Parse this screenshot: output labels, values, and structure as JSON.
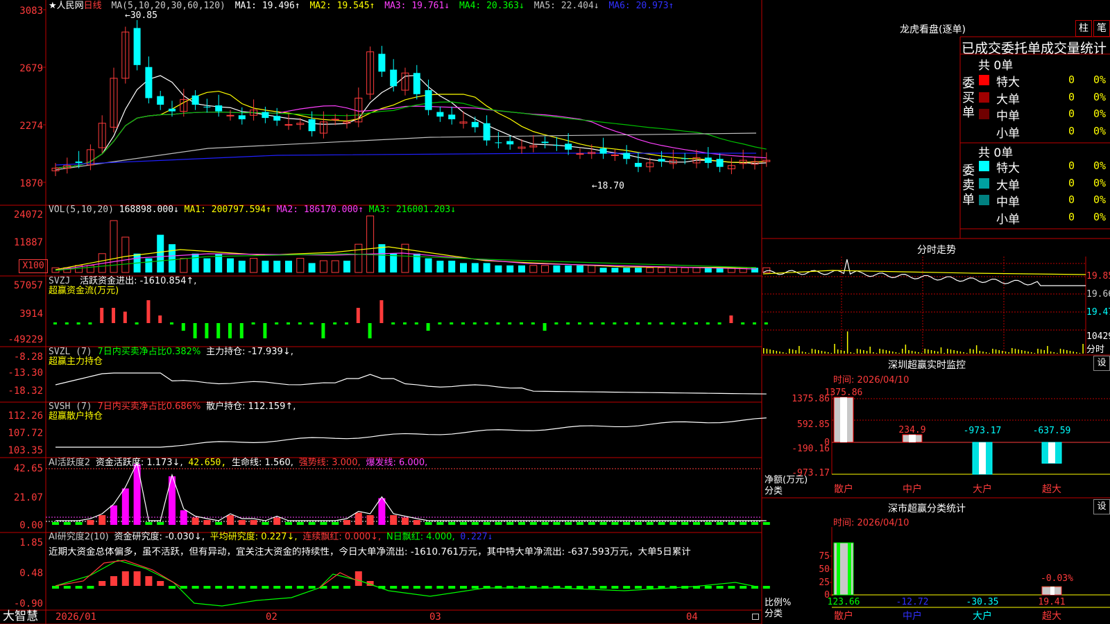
{
  "colors": {
    "up": "#ff3b3b",
    "down": "#00ffff",
    "ma_white": "#ffffff",
    "ma_yellow": "#ffff00",
    "ma_magenta": "#ff40ff",
    "ma_green": "#00c000",
    "ma_gray": "#c0c0c0",
    "ma_blue": "#2020ff",
    "grid": "#c00000",
    "green": "#00ff00"
  },
  "main": {
    "title": "★人民网",
    "period": "日线",
    "ma_label": "MA(5,10,20,30,60,120)",
    "ma1": "MA1: 19.496↑",
    "ma2": "MA2: 19.545↑",
    "ma3": "MA3: 19.761↓",
    "ma4": "MA4: 20.363↓",
    "ma5": "MA5: 22.404↓",
    "ma6": "MA6: 20.973↑",
    "high_label": "←30.85",
    "low_label": "←18.70",
    "y_ticks": [
      "3083",
      "2679",
      "2274",
      "1870"
    ]
  },
  "vol": {
    "label": "VOL(5,10,20)",
    "value": "168898.000↓",
    "ma1": "MA1: 200797.594↑",
    "ma2": "MA2: 186170.000↑",
    "ma3": "MA3: 216001.203↓",
    "y_ticks": [
      "24072",
      "11887"
    ],
    "unit": "X100"
  },
  "svzj": {
    "label": "SVZJ",
    "text": "活跃资金进出: -1610.854↑,",
    "sub": "超赢资金流(万元)",
    "y_ticks": [
      "57057",
      "3914",
      "-49229"
    ]
  },
  "svzl": {
    "label": "SVZL (7)",
    "text1": "7日内买卖净占比0.382%",
    "text2": "主力持仓: -17.939↓,",
    "sub": "超赢主力持仓",
    "y_ticks": [
      "-8.28",
      "-13.30",
      "-18.32"
    ]
  },
  "svsh": {
    "label": "SVSH (7)",
    "text1": "7日内买卖净占比0.686%",
    "text2": "散户持仓: 112.159↑,",
    "sub": "超赢散户持仓",
    "y_ticks": [
      "112.26",
      "107.72",
      "103.35"
    ]
  },
  "ai1": {
    "label": "AI活跃度2",
    "t1": "资金活跃度: 1.173↓,",
    "t2": "42.650,",
    "t3": "生命线: 1.560,",
    "t4": "强势线: 3.000,",
    "t5": "爆发线: 6.000,",
    "y_ticks": [
      "42.65",
      "21.07",
      "0.00"
    ]
  },
  "ai2": {
    "label": "AI研究度2(10)",
    "t1": "资金研究度: -0.030↓,",
    "t2": "平均研究度: 0.227↓,",
    "t3": "连续飘红: 0.000↓,",
    "t4": "N日飘红: 4.000,",
    "t5": "0.227↓",
    "comment": "近期大资金总体偏多，虽不活跃，但有异动，宜关注大资金的持续性，今日大单净流出: -1610.761万元，其中特大单净流出: -637.593万元，大单5日累计",
    "y_ticks": [
      "1.85",
      "0.48",
      "-0.90"
    ]
  },
  "bottom": {
    "brand": "大智慧",
    "dates": [
      "2026/01",
      "02",
      "03",
      "04"
    ]
  },
  "lhb": {
    "title": "龙虎看盘(逐单)",
    "btn1": "柱",
    "btn2": "笔",
    "header": "已成交委托单成交量统计",
    "buy_label": "委买单",
    "sell_label": "委卖单",
    "buy_total": "共 0单",
    "sell_total": "共 0单",
    "buy_rows": [
      {
        "name": "特大",
        "qty": "0",
        "pct": "0%",
        "color": "#ff0000"
      },
      {
        "name": "大单",
        "qty": "0",
        "pct": "0%",
        "color": "#a00000"
      },
      {
        "name": "中单",
        "qty": "0",
        "pct": "0%",
        "color": "#700000"
      },
      {
        "name": "小单",
        "qty": "0",
        "pct": "0%",
        "color": ""
      }
    ],
    "sell_rows": [
      {
        "name": "特大",
        "qty": "0",
        "pct": "0%",
        "color": "#00ffff"
      },
      {
        "name": "大单",
        "qty": "0",
        "pct": "0%",
        "color": "#00a0a0"
      },
      {
        "name": "中单",
        "qty": "0",
        "pct": "0%",
        "color": "#008080"
      },
      {
        "name": "小单",
        "qty": "0",
        "pct": "0%",
        "color": ""
      }
    ]
  },
  "intraday": {
    "title": "分时走势",
    "prices": [
      "19.85",
      "19.66",
      "19.47"
    ],
    "vol": "10429",
    "vol_unit": "分时"
  },
  "monitor": {
    "title": "深圳超赢实时监控",
    "btn": "设",
    "time": "时间: 2026/04/10",
    "ylabel": "净额(万元)",
    "xlabel": "分类",
    "y_ticks": [
      "1375.86",
      "592.85",
      "0",
      "-190.16",
      "-973.17"
    ],
    "categories": [
      "散户",
      "中户",
      "大户",
      "超大"
    ],
    "values": [
      1375.86,
      234.9,
      -973.17,
      -637.59
    ],
    "value_labels": [
      "1375.86",
      "234.9",
      "-973.17",
      "-637.59"
    ]
  },
  "classify": {
    "title": "深市超赢分类统计",
    "btn": "设",
    "time": "时间: 2026/04/10",
    "ylabel": "比例%",
    "xlabel": "分类",
    "y_ticks": [
      "75",
      "50",
      "25",
      "0"
    ],
    "categories": [
      "散户",
      "中户",
      "大户",
      "超大"
    ],
    "values": [
      123.66,
      -12.72,
      -30.35,
      19.41
    ],
    "value_labels": [
      "123.66",
      "-12.72",
      "-30.35",
      "19.41"
    ],
    "extra_label": "-0.03%"
  }
}
